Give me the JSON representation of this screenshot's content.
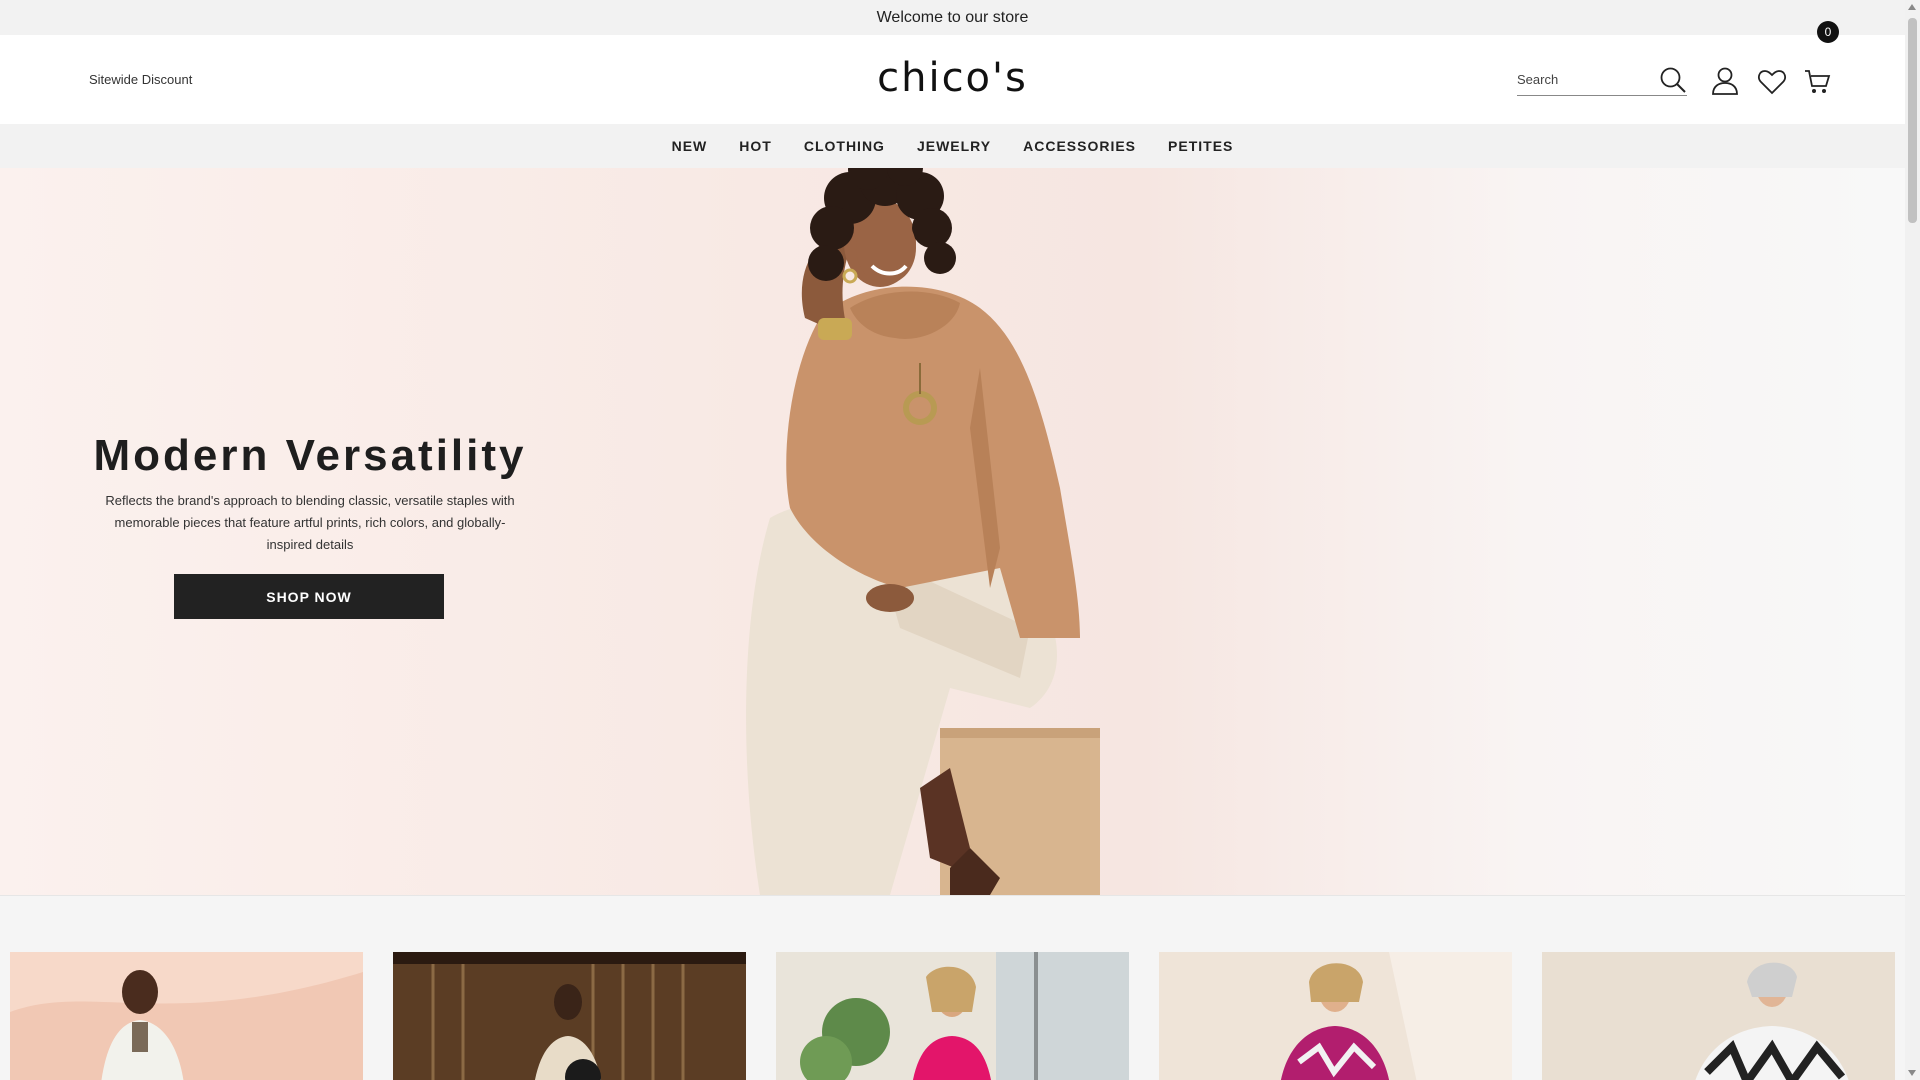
{
  "announcement": "Welcome to our store",
  "header": {
    "sitewide_link": "Sitewide Discount",
    "logo": "chico's",
    "search_placeholder": "Search",
    "cart_count": "0"
  },
  "nav": [
    "NEW",
    "HOT",
    "CLOTHING",
    "JEWELRY",
    "ACCESSORIES",
    "PETITES"
  ],
  "hero": {
    "title": "Modern Versatility",
    "subtitle": "Reflects the brand's approach to blending classic, versatile staples with memorable pieces that feature artful prints, rich colors, and globally-inspired details",
    "button": "SHOP NOW"
  },
  "colors": {
    "announcement_bg": "#f2f2f2",
    "nav_bg": "#f2f2f2",
    "button_bg": "#222222",
    "badge_bg": "#111111"
  },
  "icons": [
    "search-icon",
    "account-icon",
    "heart-icon",
    "cart-icon"
  ]
}
